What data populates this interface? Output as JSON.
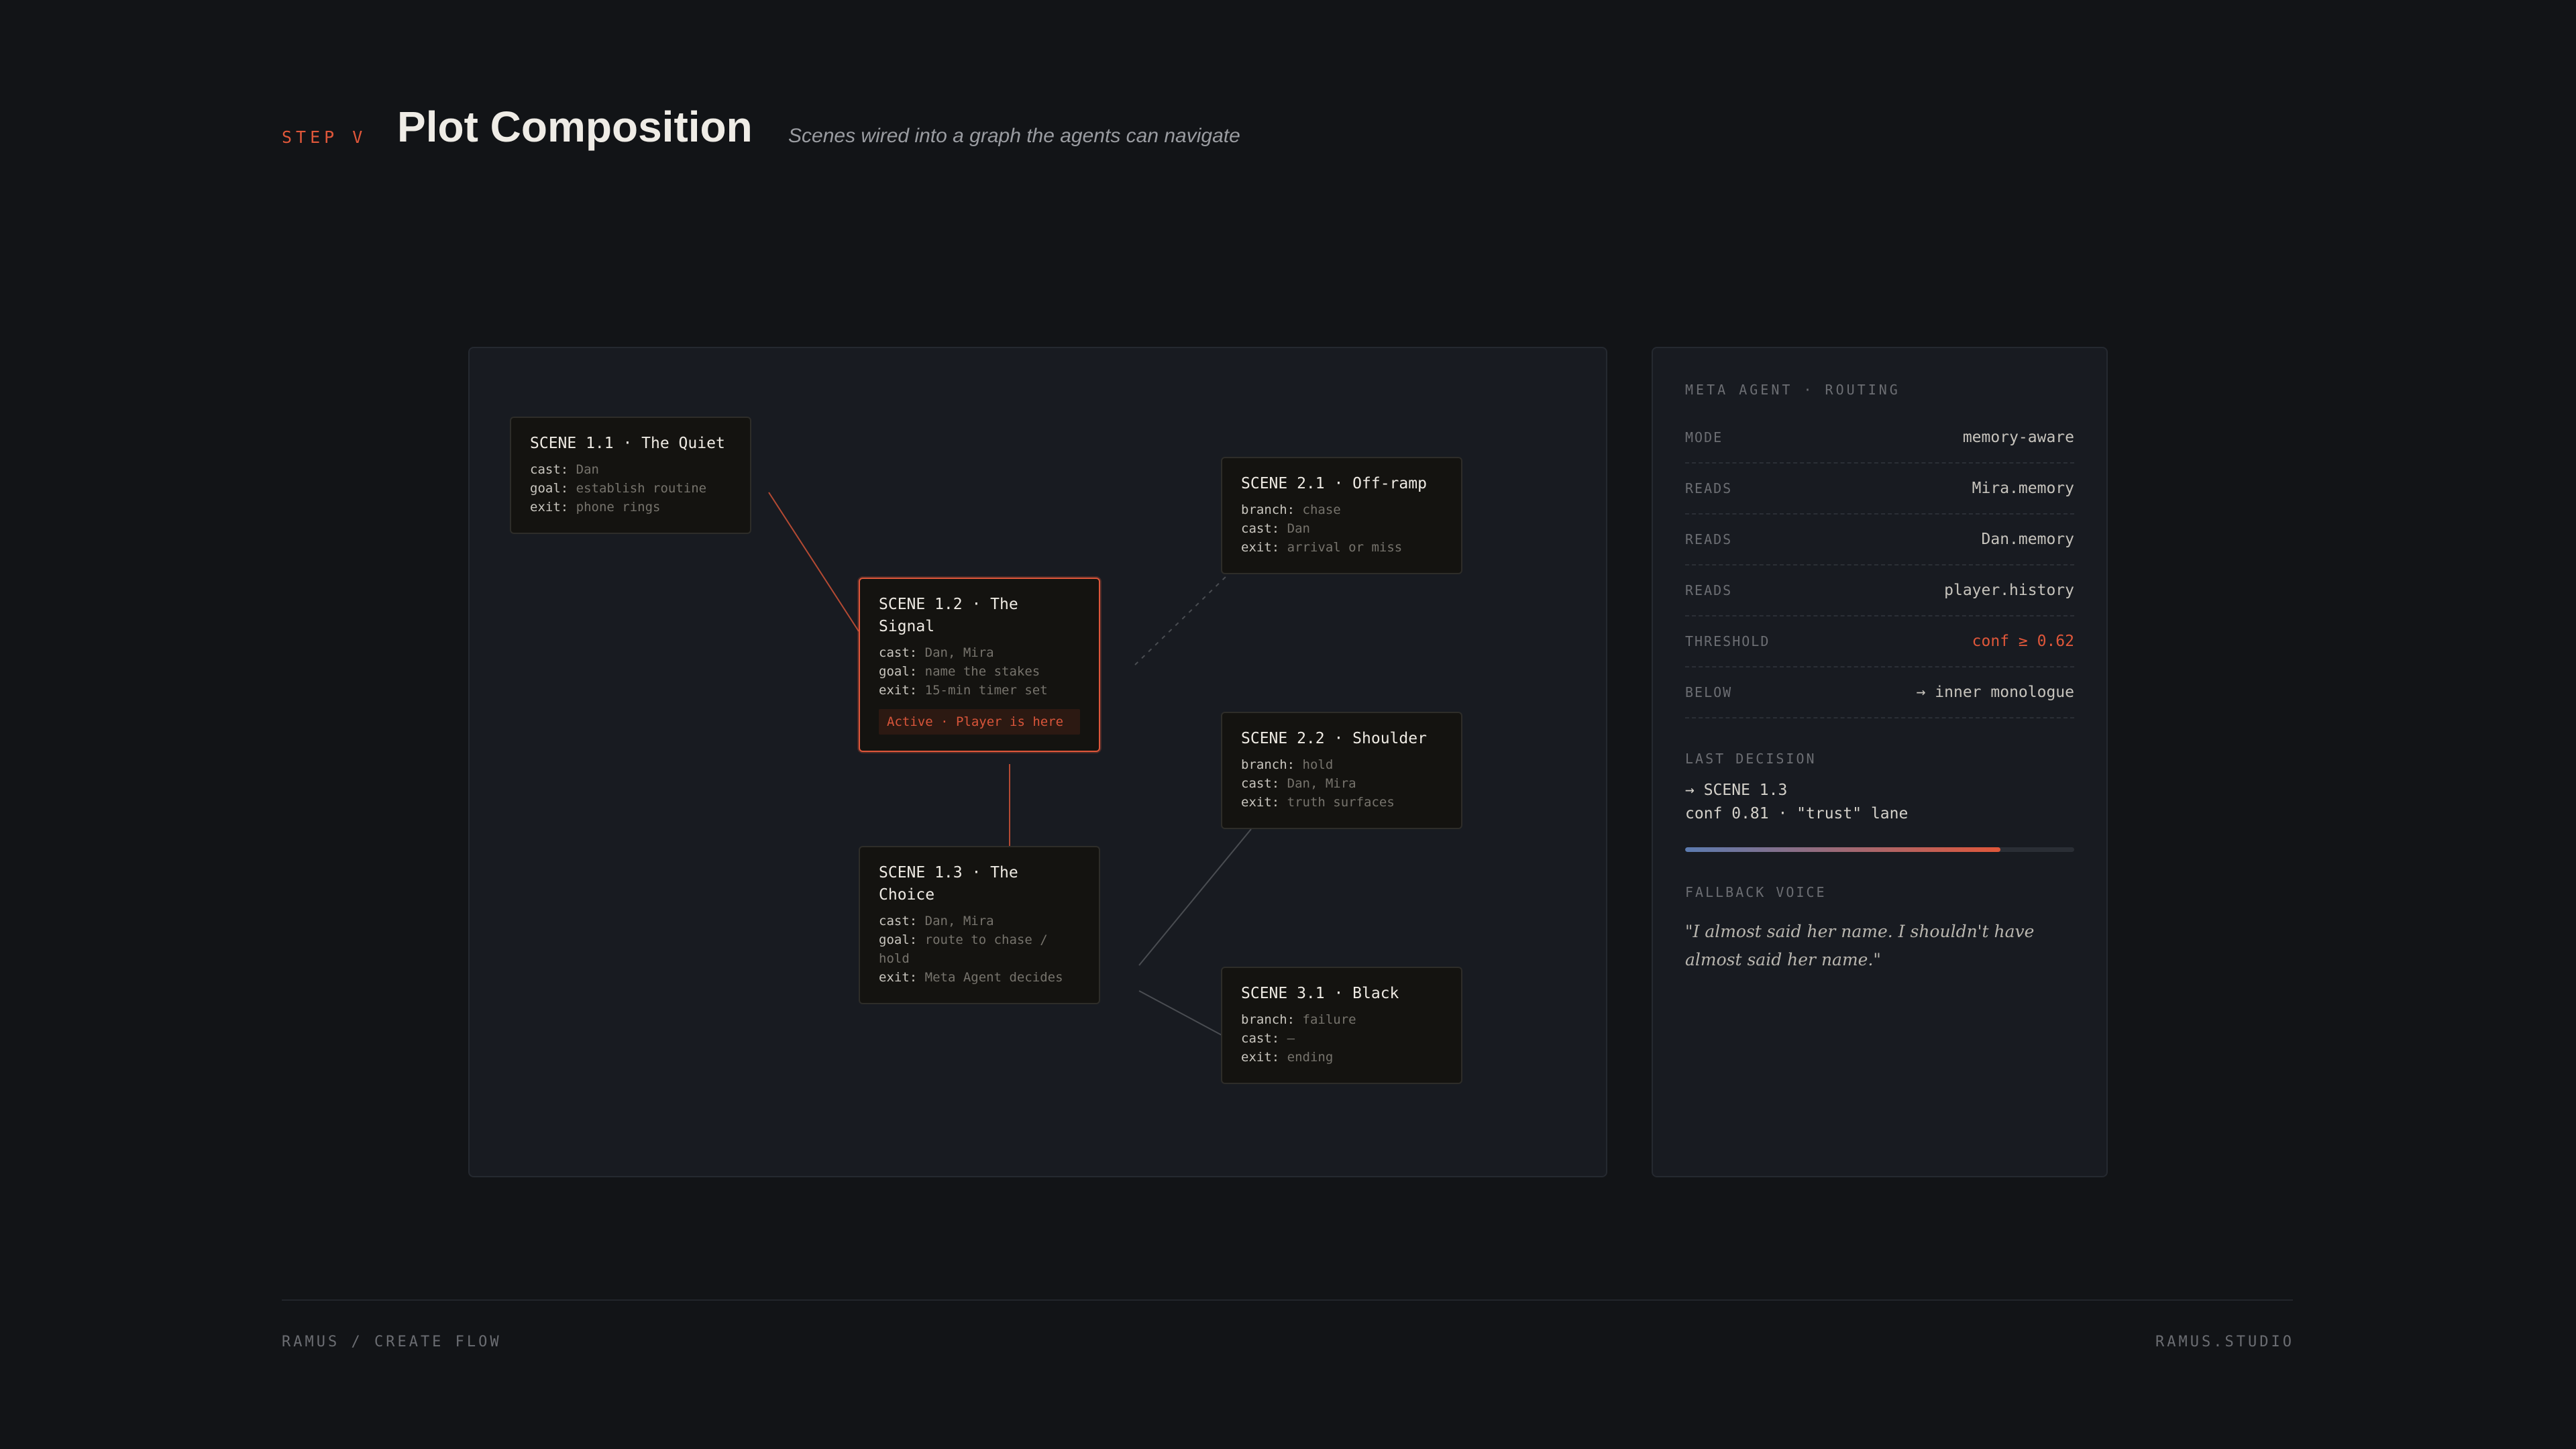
{
  "header": {
    "step": "STEP V",
    "title": "Plot Composition",
    "subtitle": "Scenes wired into a graph the agents can navigate"
  },
  "graph": {
    "edges": [
      {
        "from": "s11",
        "to": "s12",
        "style": "solid-accent"
      },
      {
        "from": "s12",
        "to": "s13",
        "style": "solid-accent"
      },
      {
        "from": "s12",
        "to": "s21",
        "style": "dashed"
      },
      {
        "from": "s13",
        "to": "s22",
        "style": "solid"
      },
      {
        "from": "s13",
        "to": "s31",
        "style": "solid"
      }
    ],
    "nodes": {
      "s11": {
        "title": "SCENE 1.1 · The Quiet",
        "f1k": "cast:",
        "f1v": "Dan",
        "f2k": "goal:",
        "f2v": "establish routine",
        "f3k": "exit:",
        "f3v": "phone rings"
      },
      "s12": {
        "title": "SCENE 1.2 · The Signal",
        "f1k": "cast:",
        "f1v": "Dan, Mira",
        "f2k": "goal:",
        "f2v": "name the stakes",
        "f3k": "exit:",
        "f3v": "15-min timer set",
        "badge": "Active · Player is here"
      },
      "s13": {
        "title": "SCENE 1.3 · The Choice",
        "f1k": "cast:",
        "f1v": "Dan, Mira",
        "f2k": "goal:",
        "f2v": "route to chase / hold",
        "f3k": "exit:",
        "f3v": "Meta Agent decides"
      },
      "s21": {
        "title": "SCENE 2.1 · Off-ramp",
        "f1k": "branch:",
        "f1v": "chase",
        "f2k": "cast:",
        "f2v": "Dan",
        "f3k": "exit:",
        "f3v": "arrival or miss"
      },
      "s22": {
        "title": "SCENE 2.2 · Shoulder",
        "f1k": "branch:",
        "f1v": "hold",
        "f2k": "cast:",
        "f2v": "Dan, Mira",
        "f3k": "exit:",
        "f3v": "truth surfaces"
      },
      "s31": {
        "title": "SCENE 3.1 · Black",
        "f1k": "branch:",
        "f1v": "failure",
        "f2k": "cast:",
        "f2v": "–",
        "f3k": "exit:",
        "f3v": "ending"
      }
    }
  },
  "meta": {
    "heading": "META AGENT · ROUTING",
    "rows": [
      {
        "k": "MODE",
        "v": "memory-aware"
      },
      {
        "k": "READS",
        "v": "Mira.memory"
      },
      {
        "k": "READS",
        "v": "Dan.memory"
      },
      {
        "k": "READS",
        "v": "player.history"
      },
      {
        "k": "THRESHOLD",
        "v": "conf ≥ 0.62"
      },
      {
        "k": "BELOW",
        "v": "→ inner monologue"
      }
    ],
    "last_decision_label": "LAST DECISION",
    "decision_line1": "→ SCENE 1.3",
    "decision_line2": "conf 0.81 · \"trust\" lane",
    "confidence": 0.81,
    "fallback_label": "FALLBACK VOICE",
    "fallback_quote": "\"I almost said her name. I shouldn't have almost said her name.\""
  },
  "footer": {
    "left": "RAMUS / CREATE FLOW",
    "right": "RAMUS.STUDIO"
  },
  "colors": {
    "accent": "#e0573a",
    "background": "#121417",
    "panel": "#181b21",
    "node": "#141310"
  }
}
